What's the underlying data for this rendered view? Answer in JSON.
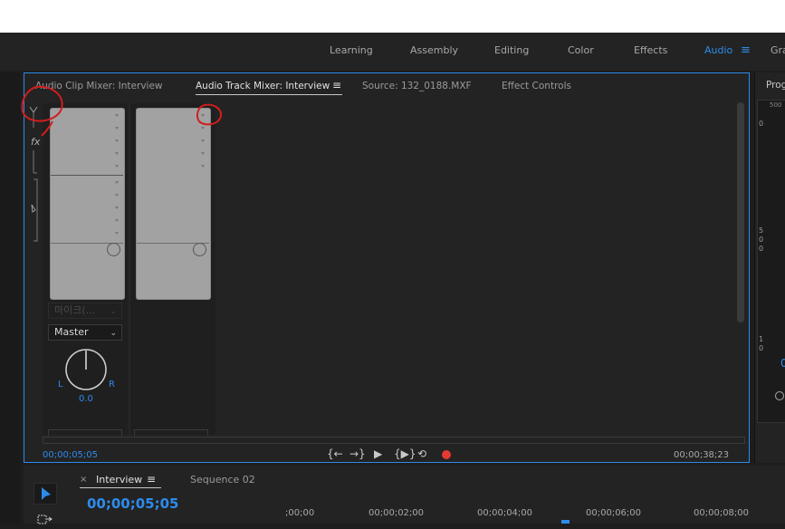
{
  "workspace_tabs": {
    "learning": "Learning",
    "assembly": "Assembly",
    "editing": "Editing",
    "color": "Color",
    "effects": "Effects",
    "audio": "Audio",
    "overflow": "Gra",
    "menu_icon": "≡"
  },
  "mixer_panel": {
    "tab_clip_mixer": "Audio Clip Mixer: Interview",
    "tab_track_mixer": "Audio Track Mixer: Interview",
    "tab_menu_icon": "≡",
    "tab_source": "Source: 132_0188.MXF",
    "tab_effect_controls": "Effect Controls",
    "strip_icons": {
      "fx": "fx"
    },
    "channel1": {
      "input_dropdown": "마이크(...",
      "output_dropdown": "Master",
      "pan_left": "L",
      "pan_right": "R",
      "pan_value": "0.0"
    },
    "time_left": "00;00;05;05",
    "time_right": "00;00;38;23",
    "transport": {
      "go_in": "{←",
      "go_out": "→}",
      "play": "▶",
      "play_in_out": "{▶}",
      "loop": "⟲",
      "record_color": "#e53935"
    }
  },
  "program_panel": {
    "tab_partial": "Prog",
    "ruler_top": "500",
    "meter_0": "0",
    "meter_50": "5 0 0",
    "meter_1": "1 0",
    "readout_partial": "0"
  },
  "timeline": {
    "tab_close": "×",
    "tab_interview": "Interview",
    "tab_menu_icon": "≡",
    "tab_sequence": "Sequence 02",
    "timecode": "00;00;05;05",
    "ruler": [
      ";00;00",
      "00;00;02;00",
      "00;00;04;00",
      "00;00;06;00",
      "00;00;08;00"
    ]
  },
  "colors": {
    "accent": "#2d8ceb",
    "annotation": "#d21d1d"
  }
}
